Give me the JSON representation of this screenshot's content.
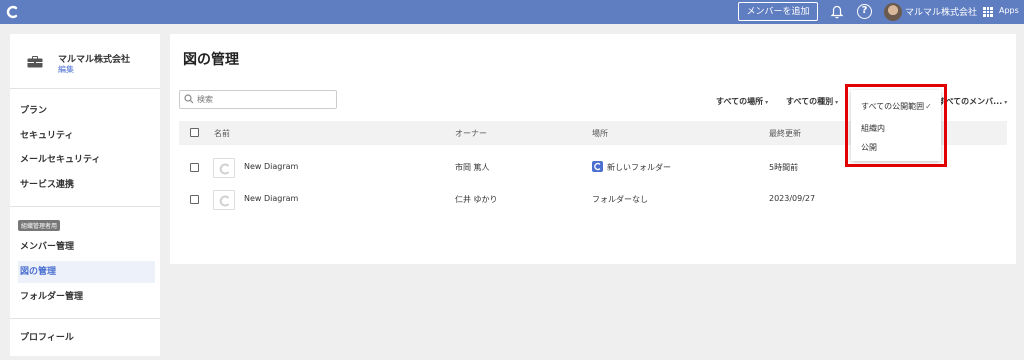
{
  "topbar": {
    "add_member_label": "メンバーを追加",
    "help_label": "?",
    "company_name": "マルマル株式会社",
    "apps_label": "Apps"
  },
  "sidebar": {
    "org_name": "マルマル株式会社",
    "org_edit_label": "編集",
    "items_top": [
      "プラン",
      "セキュリティ",
      "メールセキュリティ",
      "サービス連携"
    ],
    "admin_badge": "組織管理者用",
    "items_admin": [
      "メンバー管理",
      "図の管理",
      "フォルダー管理"
    ],
    "item_profile": "プロフィール",
    "active_item": "図の管理"
  },
  "main": {
    "title": "図の管理",
    "search_placeholder": "検索",
    "filters": [
      "すべての場所",
      "すべての種別",
      "すべてのメンバ..."
    ],
    "columns": [
      "名前",
      "オーナー",
      "場所",
      "最終更新"
    ],
    "rows": [
      {
        "name": "New Diagram",
        "owner": "市岡 篤人",
        "location": "新しいフォルダー",
        "updated": "5時間前"
      },
      {
        "name": "New Diagram",
        "owner": "仁井 ゆかり",
        "location": "フォルダーなし",
        "updated": "2023/09/27"
      }
    ]
  },
  "dropdown": {
    "items": [
      "すべての公開範囲",
      "組織内",
      "公開"
    ],
    "selected": "すべての公開範囲"
  },
  "colors": {
    "header": "#5f7dc1",
    "accent": "#4a6fd1",
    "highlight": "#e00000"
  }
}
